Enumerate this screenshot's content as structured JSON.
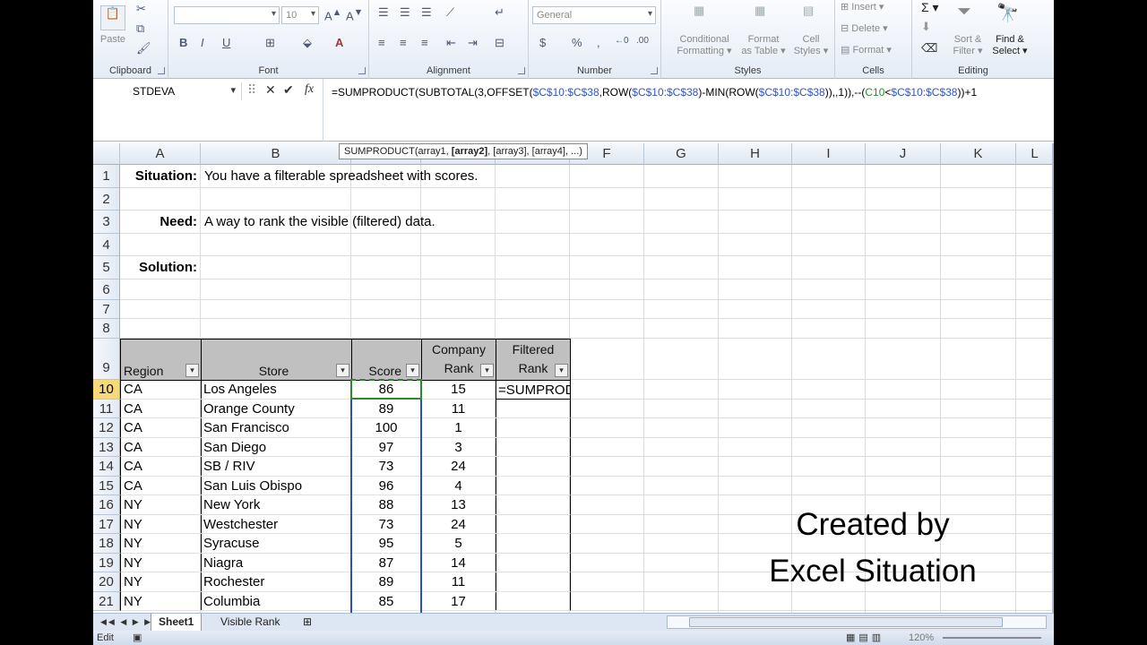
{
  "ribbon": {
    "groups": {
      "clipboard": "Clipboard",
      "font": "Font",
      "alignment": "Alignment",
      "number": "Number",
      "styles": "Styles",
      "cells": "Cells",
      "editing": "Editing"
    },
    "paste": "Paste",
    "font_size": "10",
    "number_format": "General",
    "conditional_formatting": [
      "Conditional",
      "Formatting ▾"
    ],
    "format_as_table": [
      "Format",
      "as Table ▾"
    ],
    "cell_styles": [
      "Cell",
      "Styles ▾"
    ],
    "insert": "Insert ▾",
    "delete": "Delete ▾",
    "format": "Format ▾",
    "sort_filter": [
      "Sort &",
      "Filter ▾"
    ],
    "find_select": [
      "Find &",
      "Select ▾"
    ]
  },
  "formula_bar": {
    "name_box": "STDEVA",
    "formula_parts": [
      {
        "t": "=SUMPRODUCT(SUBTOTAL(3,OFFSET(",
        "c": ""
      },
      {
        "t": "$C$10:$C$38",
        "c": "r1"
      },
      {
        "t": ",ROW(",
        "c": ""
      },
      {
        "t": "$C$10:$C$38",
        "c": "r1"
      },
      {
        "t": ")-MIN(ROW(",
        "c": ""
      },
      {
        "t": "$C$10:$C$38",
        "c": "r1"
      },
      {
        "t": ")),,1)),--(",
        "c": ""
      },
      {
        "t": "C10",
        "c": "r2"
      },
      {
        "t": "<",
        "c": ""
      },
      {
        "t": "$C$10:$C$38",
        "c": "r1"
      },
      {
        "t": "))+1",
        "c": ""
      }
    ]
  },
  "tooltip": {
    "pre": "SUMPRODUCT(array1, ",
    "bold": "[array2]",
    "post": ", [array3], [array4], ...)"
  },
  "columns": [
    "A",
    "B",
    "C",
    "D",
    "E",
    "F",
    "G",
    "H",
    "I",
    "J",
    "K",
    "L"
  ],
  "rows": [
    "1",
    "2",
    "3",
    "4",
    "5",
    "6",
    "7",
    "8",
    "9",
    "10",
    "11",
    "12",
    "13",
    "14",
    "15",
    "16",
    "17",
    "18",
    "19",
    "20",
    "21"
  ],
  "notes": {
    "situation_label": "Situation:",
    "situation_text": "You have a filterable spreadsheet with scores.",
    "need_label": "Need:",
    "need_text": "A way to rank the visible (filtered) data.",
    "solution_label": "Solution:"
  },
  "table": {
    "headers": [
      "Region",
      "Store",
      "Score",
      "Company Rank",
      "Filtered Rank"
    ],
    "editing_value": "=SUMPRODUCT(",
    "rows": [
      [
        "CA",
        "Los Angeles",
        "86",
        "15"
      ],
      [
        "CA",
        "Orange County",
        "89",
        "11"
      ],
      [
        "CA",
        "San Francisco",
        "100",
        "1"
      ],
      [
        "CA",
        "San Diego",
        "97",
        "3"
      ],
      [
        "CA",
        "SB / RIV",
        "73",
        "24"
      ],
      [
        "CA",
        "San Luis Obispo",
        "96",
        "4"
      ],
      [
        "NY",
        "New York",
        "88",
        "13"
      ],
      [
        "NY",
        "Westchester",
        "73",
        "24"
      ],
      [
        "NY",
        "Syracuse",
        "95",
        "5"
      ],
      [
        "NY",
        "Niagra",
        "87",
        "14"
      ],
      [
        "NY",
        "Rochester",
        "89",
        "11"
      ],
      [
        "NY",
        "Columbia",
        "85",
        "17"
      ]
    ]
  },
  "credit": [
    "Created by",
    "Excel Situation"
  ],
  "sheet_tabs": [
    "Sheet1",
    "Visible Rank"
  ],
  "status": {
    "mode": "Edit",
    "zoom": "120%"
  }
}
